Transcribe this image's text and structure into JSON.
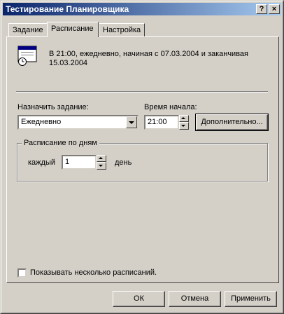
{
  "window": {
    "title": "Тестирование Планировщика",
    "help_button": "?",
    "close_button": "×"
  },
  "tabs": [
    {
      "label": "Задание"
    },
    {
      "label": "Расписание"
    },
    {
      "label": "Настройка"
    }
  ],
  "summary": {
    "line1": "В 21:00, ежедневно, начиная с 07.03.2004 и заканчивая",
    "line2": "15.03.2004"
  },
  "schedule": {
    "label": "Назначить задание:",
    "value": "Ежедневно"
  },
  "start_time": {
    "label": "Время начала:",
    "value": "21:00"
  },
  "advanced_button": "Дополнительно...",
  "daily_group": {
    "title": "Расписание по дням",
    "every_label": "каждый",
    "every_value": "1",
    "unit": "день"
  },
  "multiple_schedules": {
    "label": "Показывать несколько расписаний.",
    "checked": false
  },
  "buttons": {
    "ok": "ОК",
    "cancel": "Отмена",
    "apply": "Применить"
  }
}
